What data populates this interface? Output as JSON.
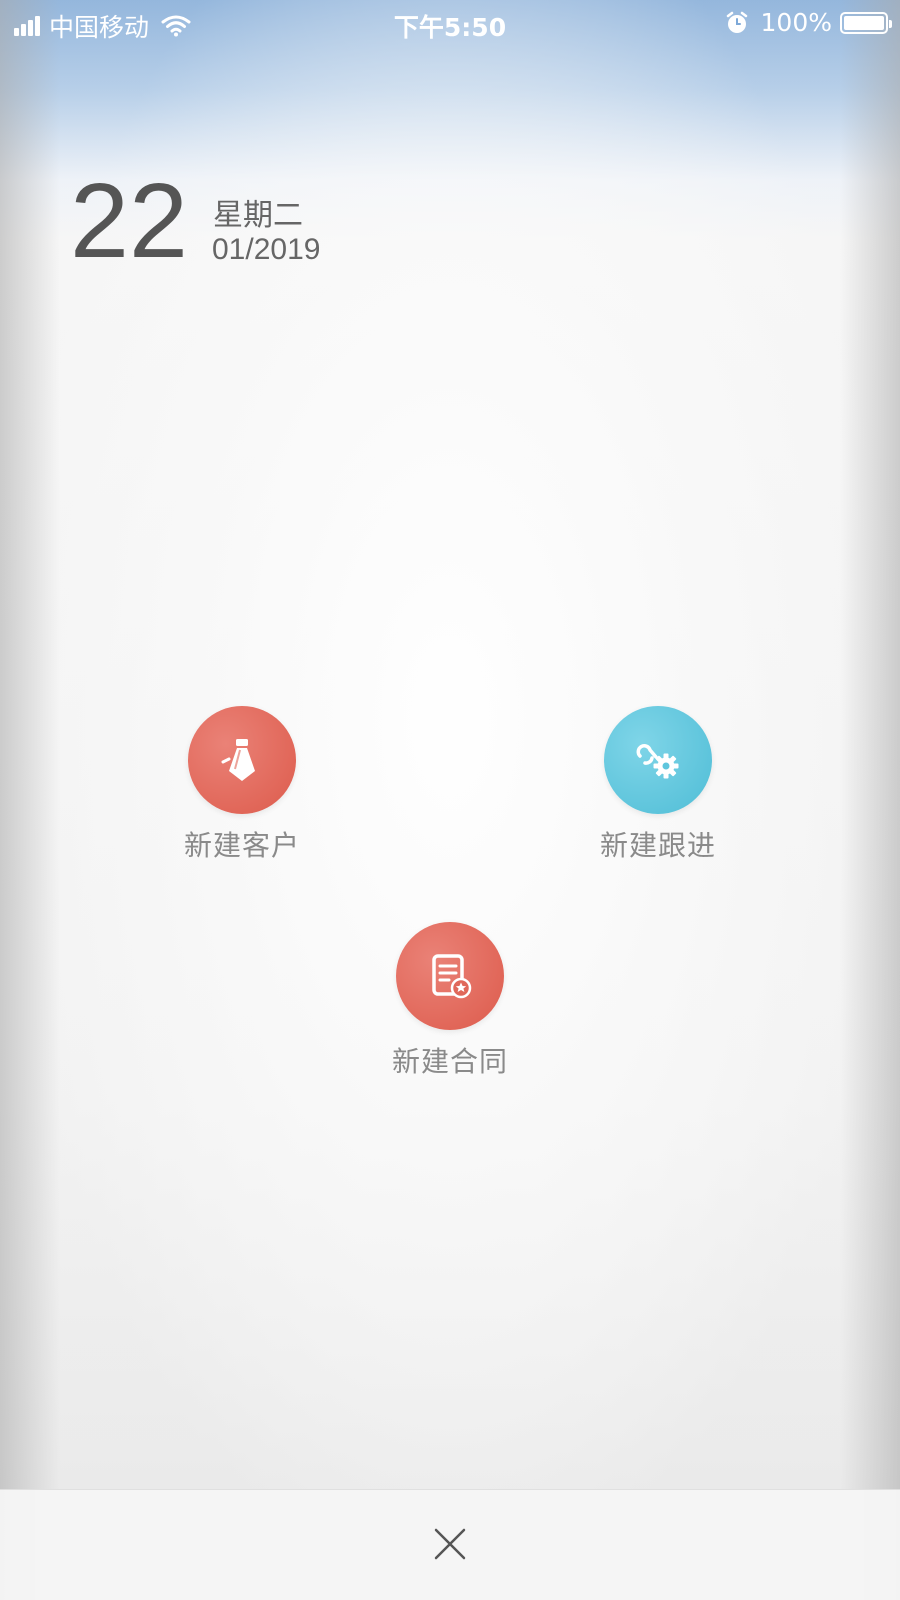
{
  "status_bar": {
    "carrier": "中国移动",
    "time": "下午5:50",
    "battery": "100%",
    "icons": [
      "signal-icon",
      "wifi-icon",
      "alarm-icon",
      "battery-icon"
    ]
  },
  "date": {
    "day": "22",
    "weekday": "星期二",
    "month_year": "01/2019"
  },
  "actions": [
    {
      "label": "新建客户",
      "icon": "tie-icon",
      "color": "#e0685a"
    },
    {
      "label": "新建跟进",
      "icon": "link-gear-icon",
      "color": "#5ec6dd"
    },
    {
      "label": "新建合同",
      "icon": "contract-icon",
      "color": "#e0685a"
    }
  ],
  "close": {
    "icon": "close-icon"
  }
}
